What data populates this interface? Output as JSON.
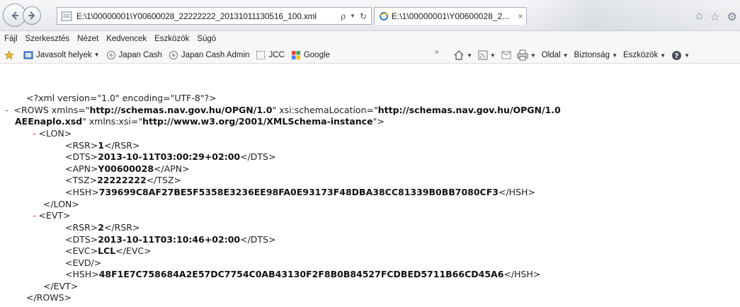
{
  "browser": {
    "address_url": "E:\\1\\00000001\\Y00600028_22222222_20131011130516_100.xml",
    "search_glyph": "ρ",
    "tab_title": "E:\\1\\00000001\\Y00600028_2...",
    "tab_close": "×"
  },
  "menu": [
    "Fájl",
    "Szerkesztés",
    "Nézet",
    "Kedvencek",
    "Eszközök",
    "Súgó"
  ],
  "favorites": {
    "suggested": "Javasolt helyek",
    "items": [
      "Japan Cash",
      "Japan Cash Admin",
      "JCC",
      "Google"
    ]
  },
  "commands": {
    "page": "Oldal",
    "security": "Biztonság",
    "tools": "Eszközök"
  },
  "xml": {
    "decl": "<?xml version=\"1.0\" encoding=\"UTF-8\"?>",
    "minus": "-",
    "rows_open_prefix": "<ROWS xmlns=\"",
    "rows_ns": "http://schemas.nav.gov.hu/OPGN/1.0",
    "rows_mid": "\" xsi:schemaLocation=\"",
    "rows_loc1": "http://schemas.nav.gov.hu/OPGN/1.0",
    "rows_loc2": "AEEnaplo.xsd",
    "rows_mid2": "\" xmlns:xsi=\"",
    "rows_xsi": "http://www.w3.org/2001/XMLSchema-instance",
    "rows_end": "\">",
    "lon": {
      "open": "<LON>",
      "rsr": "1",
      "dts": "2013-10-11T03:00:29+02:00",
      "apn": "Y00600028",
      "tsz": "22222222",
      "hsh": "739699C8AF27BE5F5358E3236EE98FA0E93173F48DBA38CC81339B0BB7080CF3",
      "close": "</LON>"
    },
    "evt": {
      "open": "<EVT>",
      "rsr": "2",
      "dts": "2013-10-11T03:10:46+02:00",
      "evc": "LCL",
      "evd": "<EVD/>",
      "hsh": "48F1E7C758684A2E57DC7754C0AB43130F2F8B0B84527FCDBED5711B66CD45A6",
      "close": "</EVT>"
    },
    "rows_close": "</ROWS>",
    "tags": {
      "rsr_o": "<RSR>",
      "rsr_c": "</RSR>",
      "dts_o": "<DTS>",
      "dts_c": "</DTS>",
      "apn_o": "<APN>",
      "apn_c": "</APN>",
      "tsz_o": "<TSZ>",
      "tsz_c": "</TSZ>",
      "hsh_o": "<HSH>",
      "hsh_c": "</HSH>",
      "evc_o": "<EVC>",
      "evc_c": "</EVC>"
    }
  }
}
